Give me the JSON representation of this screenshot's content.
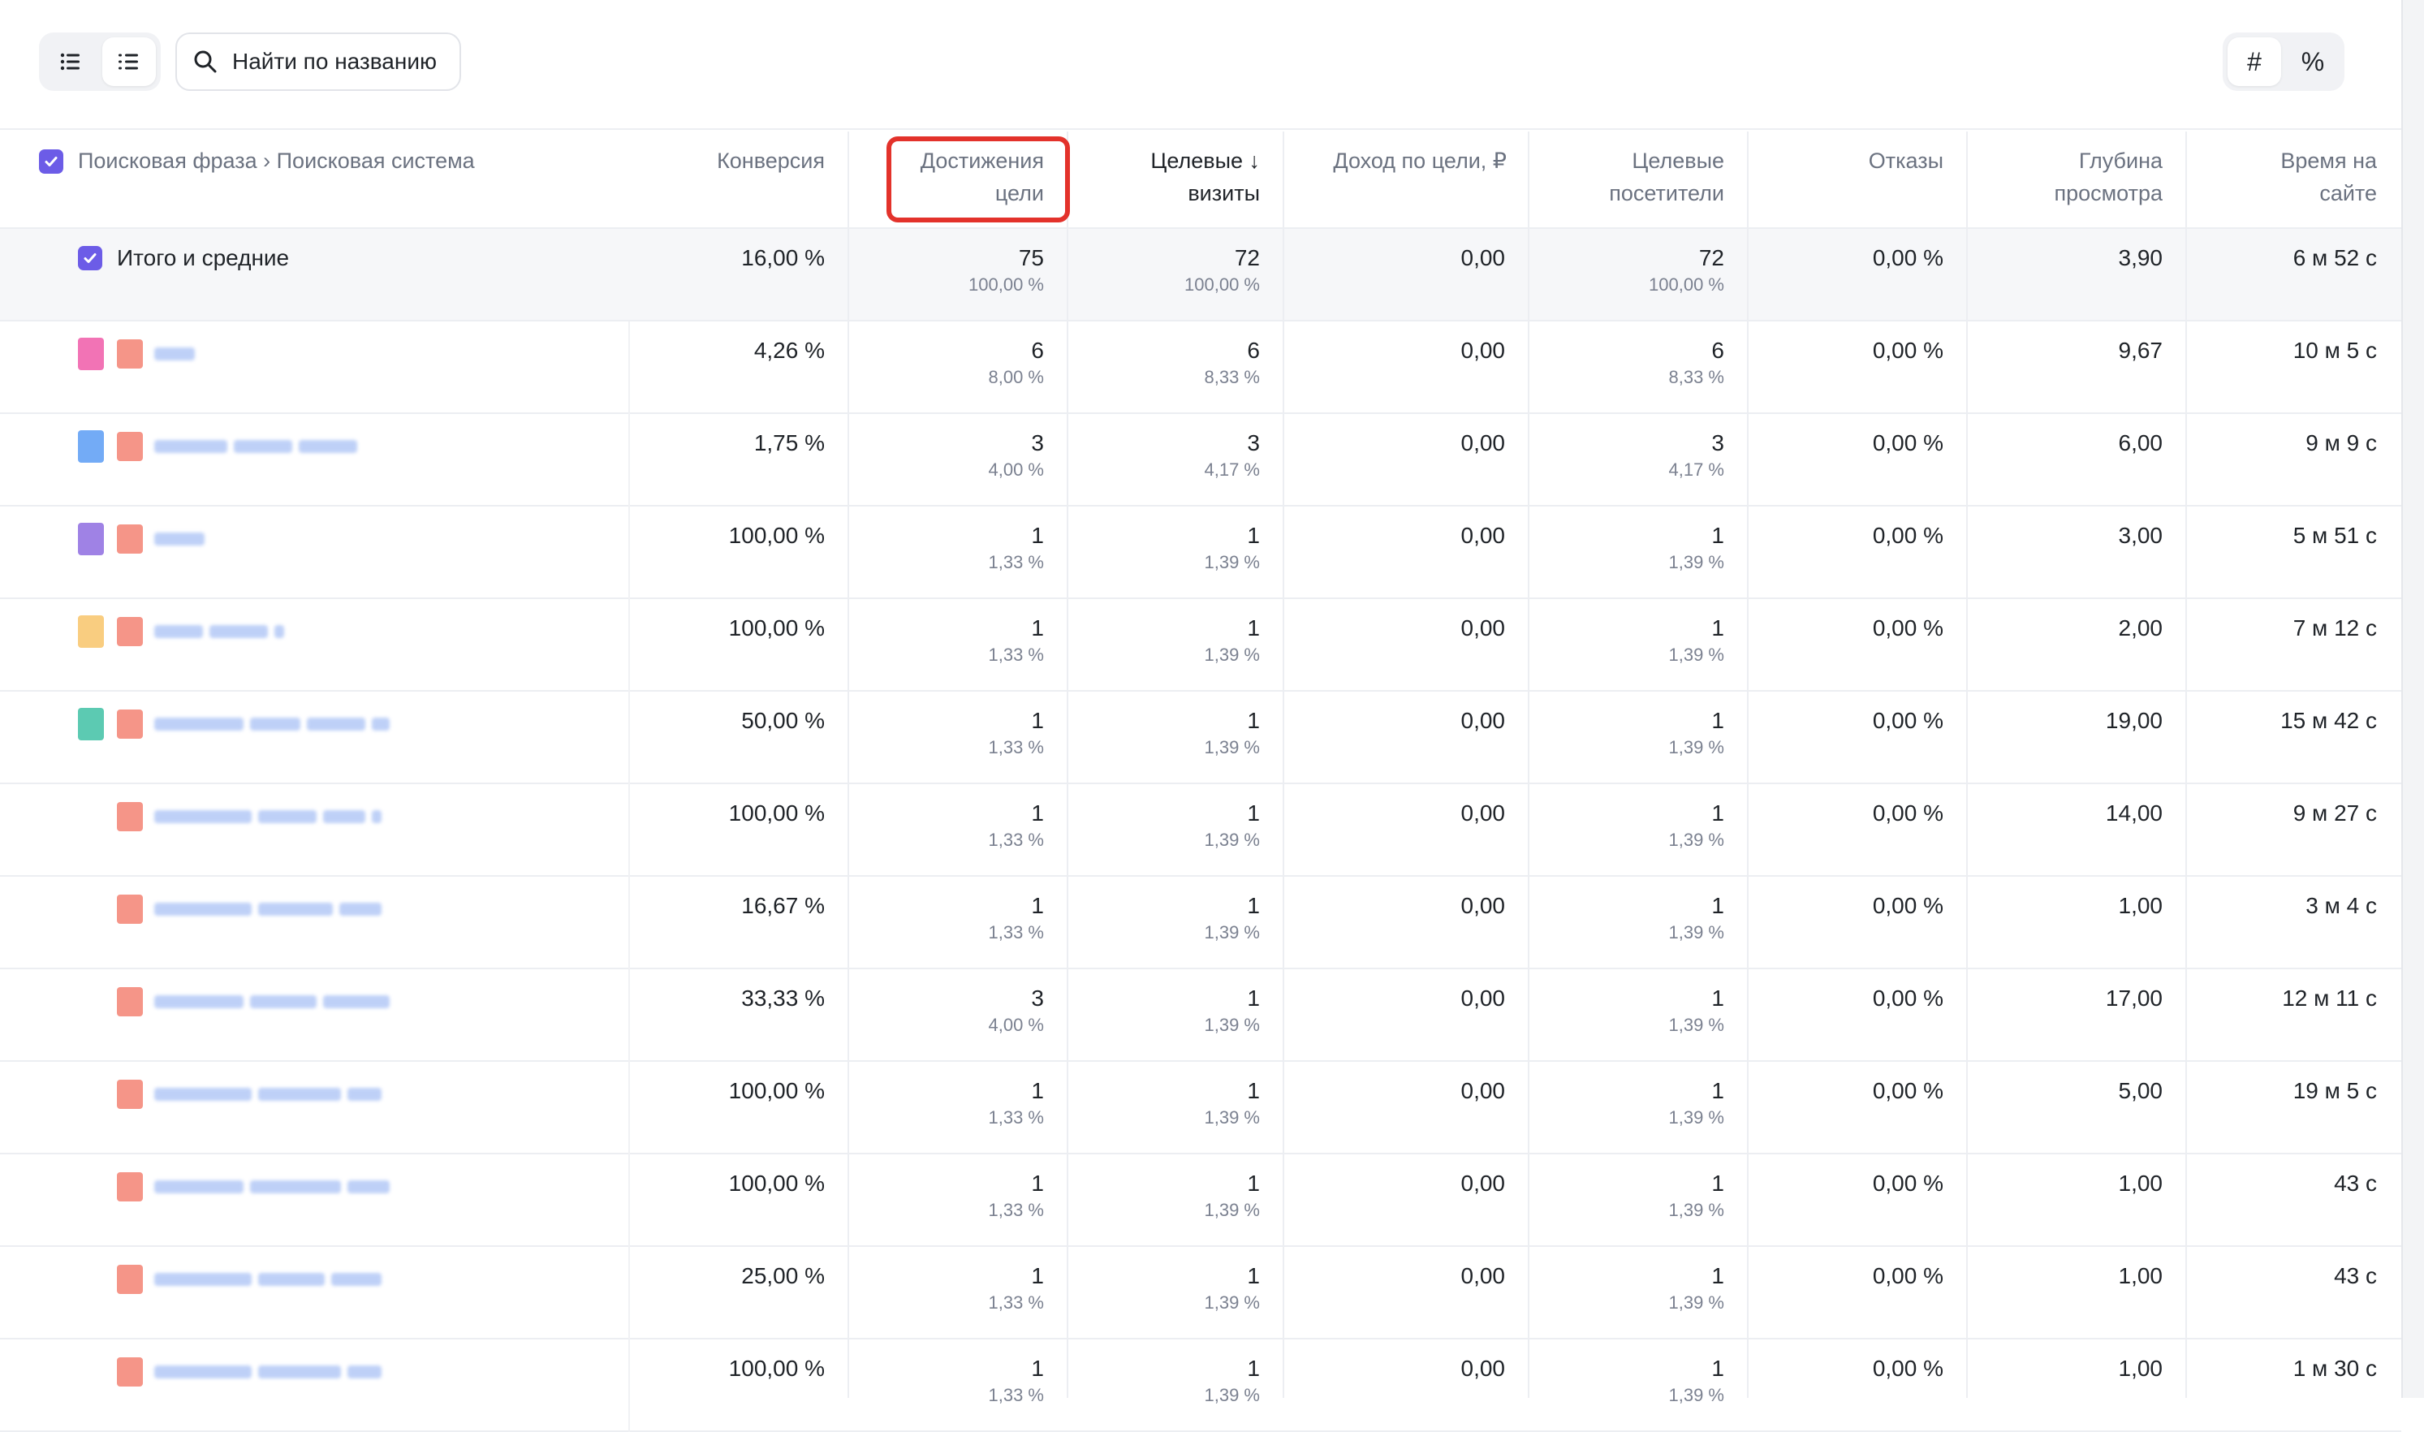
{
  "toolbar": {
    "view_icons": [
      "list-icon",
      "list-alt-icon"
    ],
    "search_label": "Найти по названию",
    "mode_hash": "#",
    "mode_percent": "%"
  },
  "columns": {
    "first": "Поисковая фраза › Поисковая система",
    "conversion": "Конверсия",
    "goal_reaches_1": "Достижения",
    "goal_reaches_2": "цели",
    "target_visits_1": "Целевые ↓",
    "target_visits_2": "визиты",
    "goal_income": "Доход по цели, ₽",
    "target_visitors_1": "Целевые",
    "target_visitors_2": "посетители",
    "bounces": "Отказы",
    "depth_1": "Глубина",
    "depth_2": "просмотра",
    "time_1": "Время на",
    "time_2": "сайте"
  },
  "total": {
    "label": "Итого и средние",
    "conversion": "16,00 %",
    "reaches": "75",
    "reaches_pct": "100,00 %",
    "visits": "72",
    "visits_pct": "100,00 %",
    "income": "0,00",
    "visitors": "72",
    "visitors_pct": "100,00 %",
    "bounces": "0,00 %",
    "depth": "3,90",
    "time": "6 м 52 с"
  },
  "rows": [
    {
      "conversion": "4,26 %",
      "reaches": "6",
      "reaches_pct": "8,00 %",
      "visits": "6",
      "visits_pct": "8,33 %",
      "income": "0,00",
      "visitors": "6",
      "visitors_pct": "8,33 %",
      "bounces": "0,00 %",
      "depth": "9,67",
      "time": "10 м 5 с",
      "swatch": "#f05aa8"
    },
    {
      "conversion": "1,75 %",
      "reaches": "3",
      "reaches_pct": "4,00 %",
      "visits": "3",
      "visits_pct": "4,17 %",
      "income": "0,00",
      "visitors": "3",
      "visitors_pct": "4,17 %",
      "bounces": "0,00 %",
      "depth": "6,00",
      "time": "9 м 9 с",
      "swatch": "#5a9cf5"
    },
    {
      "conversion": "100,00 %",
      "reaches": "1",
      "reaches_pct": "1,33 %",
      "visits": "1",
      "visits_pct": "1,39 %",
      "income": "0,00",
      "visitors": "1",
      "visitors_pct": "1,39 %",
      "bounces": "0,00 %",
      "depth": "3,00",
      "time": "5 м 51 с",
      "swatch": "#8e6ce0"
    },
    {
      "conversion": "100,00 %",
      "reaches": "1",
      "reaches_pct": "1,33 %",
      "visits": "1",
      "visits_pct": "1,39 %",
      "income": "0,00",
      "visitors": "1",
      "visitors_pct": "1,39 %",
      "bounces": "0,00 %",
      "depth": "2,00",
      "time": "7 м 12 с",
      "swatch": "#f8c46a"
    },
    {
      "conversion": "50,00 %",
      "reaches": "1",
      "reaches_pct": "1,33 %",
      "visits": "1",
      "visits_pct": "1,39 %",
      "income": "0,00",
      "visitors": "1",
      "visitors_pct": "1,39 %",
      "bounces": "0,00 %",
      "depth": "19,00",
      "time": "15 м 42 с",
      "swatch": "#3fc1a5"
    },
    {
      "conversion": "100,00 %",
      "reaches": "1",
      "reaches_pct": "1,33 %",
      "visits": "1",
      "visits_pct": "1,39 %",
      "income": "0,00",
      "visitors": "1",
      "visitors_pct": "1,39 %",
      "bounces": "0,00 %",
      "depth": "14,00",
      "time": "9 м 27 с",
      "swatch": ""
    },
    {
      "conversion": "16,67 %",
      "reaches": "1",
      "reaches_pct": "1,33 %",
      "visits": "1",
      "visits_pct": "1,39 %",
      "income": "0,00",
      "visitors": "1",
      "visitors_pct": "1,39 %",
      "bounces": "0,00 %",
      "depth": "1,00",
      "time": "3 м 4 с",
      "swatch": ""
    },
    {
      "conversion": "33,33 %",
      "reaches": "3",
      "reaches_pct": "4,00 %",
      "visits": "1",
      "visits_pct": "1,39 %",
      "income": "0,00",
      "visitors": "1",
      "visitors_pct": "1,39 %",
      "bounces": "0,00 %",
      "depth": "17,00",
      "time": "12 м 11 с",
      "swatch": ""
    },
    {
      "conversion": "100,00 %",
      "reaches": "1",
      "reaches_pct": "1,33 %",
      "visits": "1",
      "visits_pct": "1,39 %",
      "income": "0,00",
      "visitors": "1",
      "visitors_pct": "1,39 %",
      "bounces": "0,00 %",
      "depth": "5,00",
      "time": "19 м 5 с",
      "swatch": ""
    },
    {
      "conversion": "100,00 %",
      "reaches": "1",
      "reaches_pct": "1,33 %",
      "visits": "1",
      "visits_pct": "1,39 %",
      "income": "0,00",
      "visitors": "1",
      "visitors_pct": "1,39 %",
      "bounces": "0,00 %",
      "depth": "1,00",
      "time": "43 с",
      "swatch": ""
    },
    {
      "conversion": "25,00 %",
      "reaches": "1",
      "reaches_pct": "1,33 %",
      "visits": "1",
      "visits_pct": "1,39 %",
      "income": "0,00",
      "visitors": "1",
      "visitors_pct": "1,39 %",
      "bounces": "0,00 %",
      "depth": "1,00",
      "time": "43 с",
      "swatch": ""
    },
    {
      "conversion": "100,00 %",
      "reaches": "1",
      "reaches_pct": "1,33 %",
      "visits": "1",
      "visits_pct": "1,39 %",
      "income": "0,00",
      "visitors": "1",
      "visitors_pct": "1,39 %",
      "bounces": "0,00 %",
      "depth": "1,00",
      "time": "1 м 30 с",
      "swatch": ""
    }
  ],
  "colors": {
    "accent": "#6c5ce7",
    "highlight": "#e3322b",
    "engine_swatch": "#f27a6a",
    "blur_text": "#a9c1f5"
  }
}
